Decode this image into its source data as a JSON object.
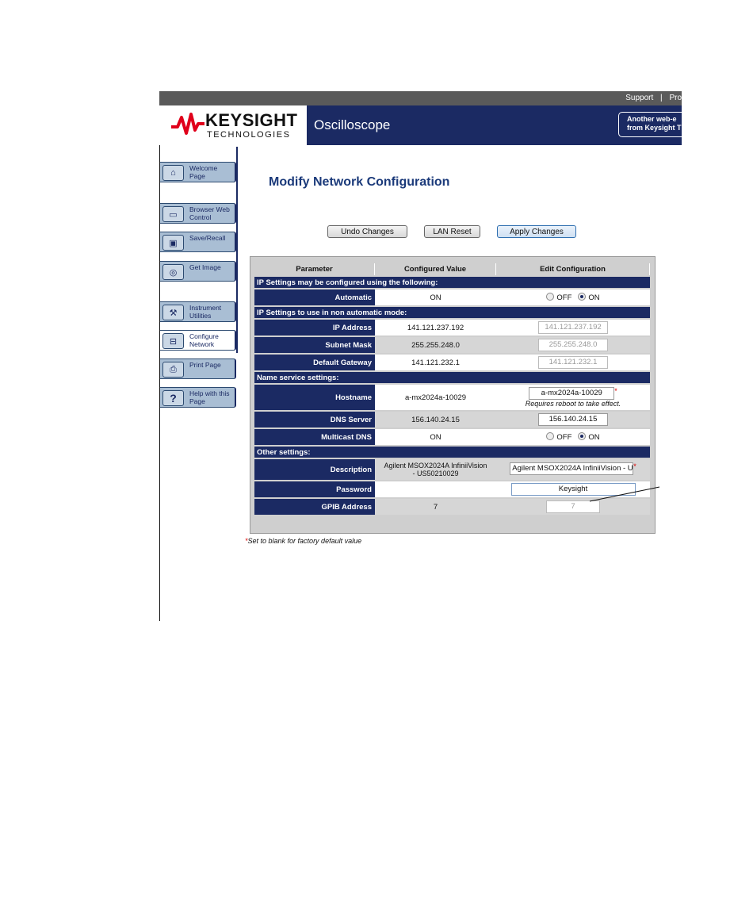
{
  "topbar": {
    "links": [
      "Support",
      "|",
      "Pro"
    ]
  },
  "brand": {
    "name": "KEYSIGHT",
    "sub": "TECHNOLOGIES",
    "product": "Oscilloscope",
    "promo_line1": "Another web-e",
    "promo_line2": "from Keysight T",
    "color": "#1b2a63",
    "accent": "#e0001b"
  },
  "nav": [
    {
      "label": "Welcome Page",
      "icon": "home-icon"
    },
    {
      "label": "Browser Web Control",
      "icon": "scope-icon"
    },
    {
      "label": "Save/Recall",
      "icon": "disk-icon"
    },
    {
      "label": "Get Image",
      "icon": "camera-icon"
    },
    {
      "label": "Instrument Utilities",
      "icon": "wrench-icon"
    },
    {
      "label": "Configure Network",
      "icon": "network-icon",
      "active": true
    },
    {
      "label": "Print Page",
      "icon": "printer-icon"
    },
    {
      "label": "Help with this Page",
      "icon": "question-icon"
    }
  ],
  "page": {
    "title": "Modify Network Configuration"
  },
  "buttons": {
    "undo": "Undo Changes",
    "lan_reset": "LAN Reset",
    "apply": "Apply Changes"
  },
  "table": {
    "headers": [
      "Parameter",
      "Configured Value",
      "Edit Configuration"
    ],
    "sec_ip_auto": "IP Settings may be configured using the following:",
    "automatic": {
      "label": "Automatic",
      "value": "ON",
      "off": "OFF",
      "on": "ON"
    },
    "sec_ip_manual": "IP Settings to use in non automatic mode:",
    "ip": {
      "label": "IP Address",
      "value": "141.121.237.192",
      "edit": "141.121.237.192"
    },
    "subnet": {
      "label": "Subnet Mask",
      "value": "255.255.248.0",
      "edit": "255.255.248.0"
    },
    "gateway": {
      "label": "Default Gateway",
      "value": "141.121.232.1",
      "edit": "141.121.232.1"
    },
    "sec_name": "Name service settings:",
    "hostname": {
      "label": "Hostname",
      "value": "a-mx2024a-10029",
      "edit": "a-mx2024a-10029",
      "star": "*",
      "note": "Requires reboot to take effect."
    },
    "dns": {
      "label": "DNS Server",
      "value": "156.140.24.15",
      "edit": "156.140.24.15"
    },
    "mdns": {
      "label": "Multicast DNS",
      "value": "ON",
      "off": "OFF",
      "on": "ON"
    },
    "sec_other": "Other settings:",
    "description": {
      "label": "Description",
      "value_line1": "Agilent MSOX2024A InfiniiVision",
      "value_line2": "- US50210029",
      "edit": "Agilent MSOX2024A InfiniiVision - U",
      "star": "*"
    },
    "password": {
      "label": "Password",
      "value": "",
      "edit": "Keysight"
    },
    "gpib": {
      "label": "GPIB Address",
      "value": "7",
      "edit": "7"
    }
  },
  "footnote": {
    "star": "*",
    "text": "Set to blank for factory default value"
  }
}
